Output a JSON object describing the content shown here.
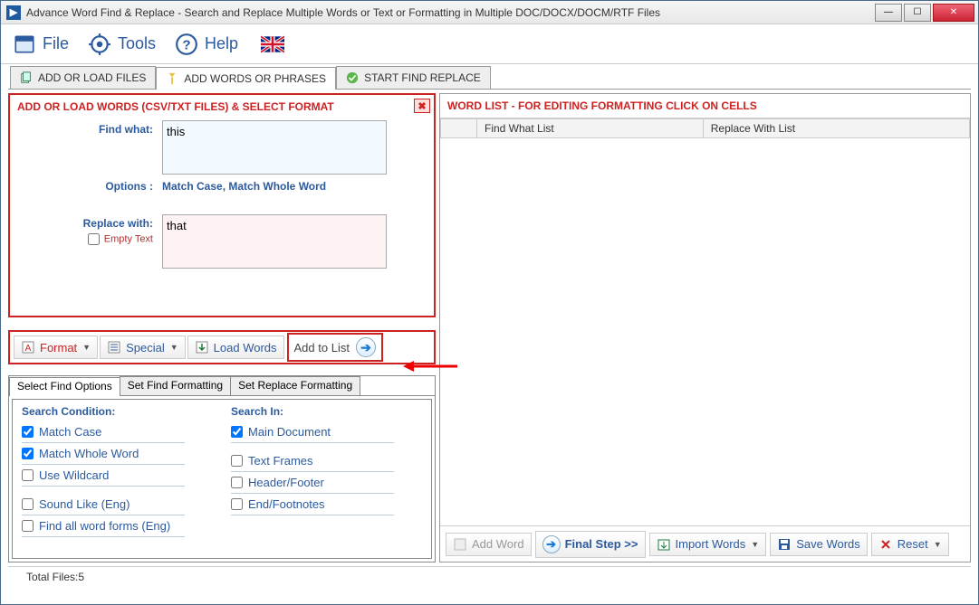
{
  "window": {
    "title": "Advance Word Find & Replace - Search and Replace Multiple Words or Text  or Formatting in Multiple DOC/DOCX/DOCM/RTF Files"
  },
  "menubar": {
    "file": "File",
    "tools": "Tools",
    "help": "Help"
  },
  "main_tabs": {
    "t1": "ADD OR LOAD FILES",
    "t2": "ADD WORDS OR PHRASES",
    "t3": "START FIND REPLACE"
  },
  "add_panel": {
    "title": "ADD OR LOAD WORDS (CSV/TXT FILES) & SELECT FORMAT",
    "find_label": "Find what:",
    "find_val": "this",
    "options_label": "Options :",
    "options_val": "Match Case, Match Whole Word",
    "replace_label": "Replace with:",
    "replace_val": "that",
    "empty_label": "Empty Text"
  },
  "btn_row": {
    "format": "Format",
    "special": "Special",
    "load": "Load Words",
    "add": "Add to List"
  },
  "sub_tabs": {
    "t1": "Select Find Options",
    "t2": "Set Find Formatting",
    "t3": "Set Replace Formatting"
  },
  "find_opts": {
    "h1": "Search Condition:",
    "h2": "Search In:",
    "c1": "Match Case",
    "c2": "Match Whole Word",
    "c3": "Use Wildcard",
    "c4": "Sound Like (Eng)",
    "c5": "Find all word forms (Eng)",
    "s1": "Main Document",
    "s2": "Text Frames",
    "s3": "Header/Footer",
    "s4": "End/Footnotes"
  },
  "right": {
    "title": "WORD LIST - FOR EDITING FORMATTING CLICK ON CELLS",
    "col1": "Find What List",
    "col2": "Replace With List"
  },
  "right_btns": {
    "add": "Add Word",
    "final": "Final Step >>",
    "import": "Import Words",
    "save": "Save Words",
    "reset": "Reset"
  },
  "status": {
    "text": "Total Files:5"
  }
}
